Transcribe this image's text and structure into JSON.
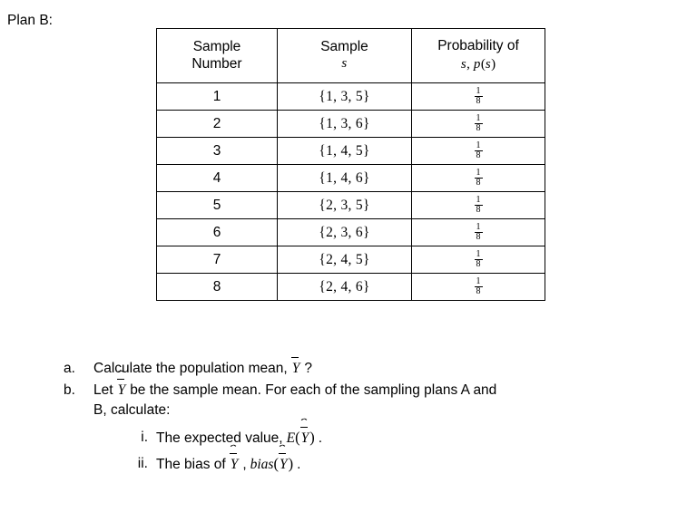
{
  "document": {
    "plan_label": "Plan B:"
  },
  "table": {
    "headers": [
      {
        "line1": "Sample",
        "line2": "Number"
      },
      {
        "line1": "Sample",
        "line2": "s"
      },
      {
        "line1": "Probability of",
        "line2": "s ,  p(s)"
      }
    ],
    "header_math": {
      "col2_symbol": "s",
      "col3_symbol_s": "s",
      "col3_comma": ",",
      "col3_p": "p",
      "col3_paren_open": "(",
      "col3_paren_close": ")"
    },
    "rows": [
      {
        "number": "1",
        "sample": "{1, 3, 5}",
        "prob_num": "1",
        "prob_den": "8"
      },
      {
        "number": "2",
        "sample": "{1, 3, 6}",
        "prob_num": "1",
        "prob_den": "8"
      },
      {
        "number": "3",
        "sample": "{1, 4, 5}",
        "prob_num": "1",
        "prob_den": "8"
      },
      {
        "number": "4",
        "sample": "{1, 4, 6}",
        "prob_num": "1",
        "prob_den": "8"
      },
      {
        "number": "5",
        "sample": "{2, 3, 5}",
        "prob_num": "1",
        "prob_den": "8"
      },
      {
        "number": "6",
        "sample": "{2, 3, 6}",
        "prob_num": "1",
        "prob_den": "8"
      },
      {
        "number": "7",
        "sample": "{2, 4, 5}",
        "prob_num": "1",
        "prob_den": "8"
      },
      {
        "number": "8",
        "sample": "{2, 4, 6}",
        "prob_num": "1",
        "prob_den": "8"
      }
    ]
  },
  "questions": {
    "a": {
      "marker": "a.",
      "text_before": "Calculate the population mean,",
      "symbol": "Y",
      "text_after": "?"
    },
    "b": {
      "marker": "b.",
      "text_before": "Let",
      "symbol": "Y",
      "text_after": "be the sample mean. For each of the sampling plans A and B, calculate:",
      "sub": [
        {
          "marker": "i.",
          "text_before": "The expected value,",
          "fn": "E",
          "paren_open": "(",
          "symbol": "Y",
          "paren_close": ")",
          "text_after": "."
        },
        {
          "marker": "ii.",
          "text_before": "The bias of",
          "symbol": "Y",
          "comma": ",",
          "fn": "bias",
          "paren_open": "(",
          "symbol2": "Y",
          "paren_close": ")",
          "text_after": "."
        }
      ]
    }
  },
  "colors": {
    "background": "#ffffff",
    "text": "#000000",
    "table_border": "#000000"
  }
}
